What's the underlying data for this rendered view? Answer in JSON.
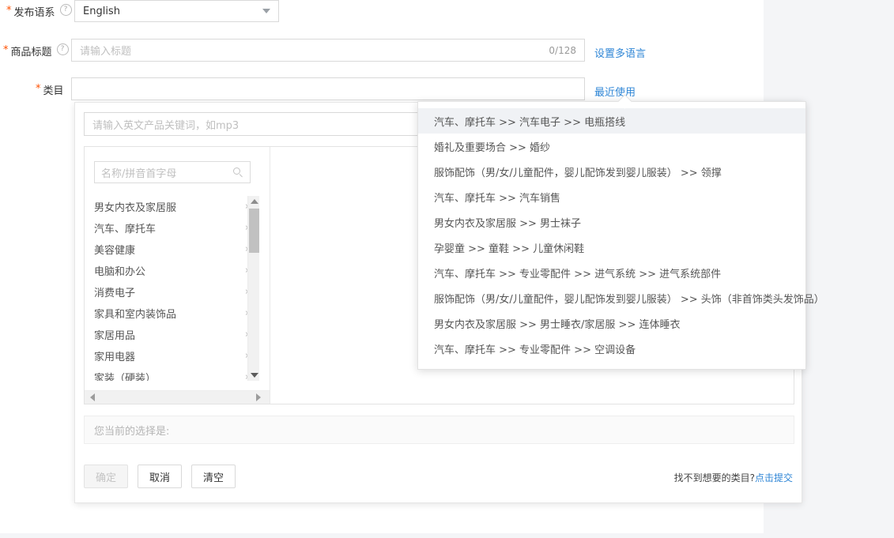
{
  "form": {
    "language_row": {
      "required_mark": "*",
      "label": "发布语系",
      "help_icon": "question-circle-icon",
      "value": "English",
      "chevron_icon": "chevron-down-icon"
    },
    "title_row": {
      "required_mark": "*",
      "label": "商品标题",
      "help_icon": "question-circle-icon",
      "placeholder": "请输入标题",
      "counter": "0/128",
      "multilang_link": "设置多语言"
    },
    "category_row": {
      "required_mark": "*",
      "label": "类目",
      "value": "",
      "recent_link": "最近使用"
    }
  },
  "recent_dropdown": {
    "items": [
      "汽车、摩托车 >> 汽车电子 >> 电瓶搭线",
      "婚礼及重要场合 >> 婚纱",
      "服饰配饰（男/女/儿童配件，婴儿配饰发到婴儿服装） >> 领撑",
      "汽车、摩托车 >> 汽车销售",
      "男女内衣及家居服 >> 男士袜子",
      "孕婴童 >> 童鞋 >> 儿童休闲鞋",
      "汽车、摩托车 >> 专业零配件 >> 进气系统 >> 进气系统部件",
      "服饰配饰（男/女/儿童配件，婴儿配饰发到婴儿服装） >> 头饰（非首饰类头发饰品）",
      "男女内衣及家居服 >> 男士睡衣/家居服 >> 连体睡衣",
      "汽车、摩托车 >> 专业零配件 >> 空调设备"
    ],
    "selected_index": 0
  },
  "category_modal": {
    "keyword_placeholder": "请输入英文产品关键词，如mp3",
    "tree_search_placeholder": "名称/拼音首字母",
    "search_icon": "search-icon",
    "tree_items": [
      "男女内衣及家居服",
      "汽车、摩托车",
      "美容健康",
      "电脑和办公",
      "消费电子",
      "家具和室内装饰品",
      "家居用品",
      "家用电器",
      "家装（硬装）"
    ],
    "item_arrow": "›",
    "scrollbar": {
      "up_icon": "triangle-up-icon",
      "down_icon": "triangle-down-icon",
      "left_icon": "triangle-left-icon",
      "right_icon": "triangle-right-icon"
    },
    "selection_label": "您当前的选择是:",
    "buttons": {
      "confirm": "确定",
      "cancel": "取消",
      "clear": "清空"
    },
    "help_text": "找不到想要的类目?",
    "help_link": "点击提交"
  },
  "colors": {
    "link": "#2f86d6",
    "required": "#ff5000",
    "highlight": "#f0f2f5",
    "page_bg": "#f4f5f7"
  }
}
